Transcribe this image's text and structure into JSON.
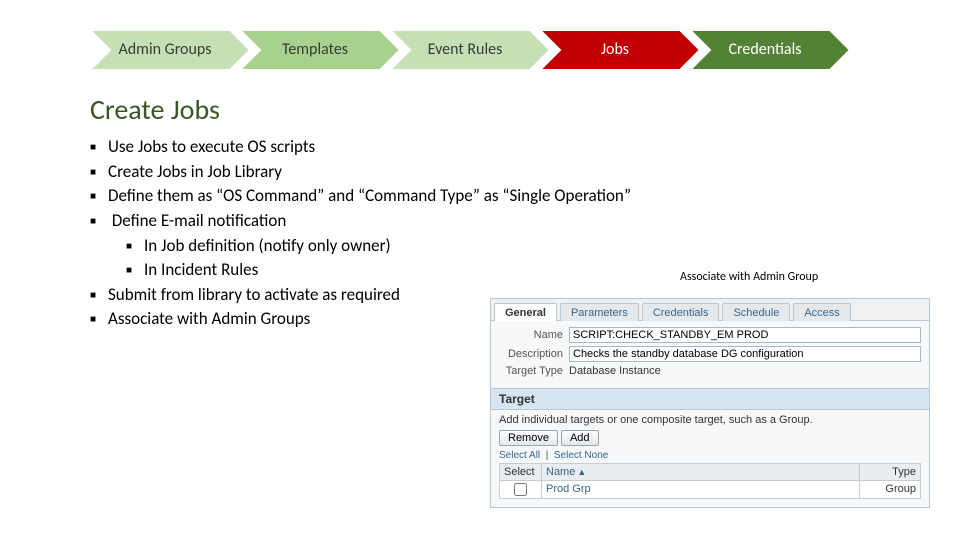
{
  "chevrons": [
    {
      "label": "Admin Groups",
      "style": "light"
    },
    {
      "label": "Templates",
      "style": "mid"
    },
    {
      "label": "Event Rules",
      "style": "light"
    },
    {
      "label": "Jobs",
      "style": "red"
    },
    {
      "label": "Credentials",
      "style": "dark"
    }
  ],
  "title": "Create Jobs",
  "bullets": {
    "b1": "Use Jobs to execute OS scripts",
    "b2": "Create Jobs in Job Library",
    "b3": "Define them as “OS Command” and “Command Type” as “Single Operation”",
    "b4": "Define E-mail notification",
    "b4a": "In Job definition (notify only owner)",
    "b4b": "In Incident Rules",
    "b5": "Submit from library to activate as required",
    "b6": "Associate with Admin Groups"
  },
  "assoc_caption": "Associate with Admin Group",
  "em": {
    "tabs": {
      "general": "General",
      "parameters": "Parameters",
      "credentials": "Credentials",
      "schedule": "Schedule",
      "access": "Access"
    },
    "name_lbl": "Name",
    "name_val": "SCRIPT:CHECK_STANDBY_EM PROD",
    "desc_lbl": "Description",
    "desc_val": "Checks the standby database DG configuration",
    "tt_lbl": "Target Type",
    "tt_val": "Database Instance",
    "target_hdr": "Target",
    "target_hint": "Add individual targets or one composite target, such as a Group.",
    "btn_remove": "Remove",
    "btn_add": "Add",
    "sel_all": "Select All",
    "sel_none": "Select None",
    "col_select": "Select",
    "col_name": "Name",
    "col_type": "Type",
    "row_name": "Prod Grp",
    "row_type": "Group"
  }
}
